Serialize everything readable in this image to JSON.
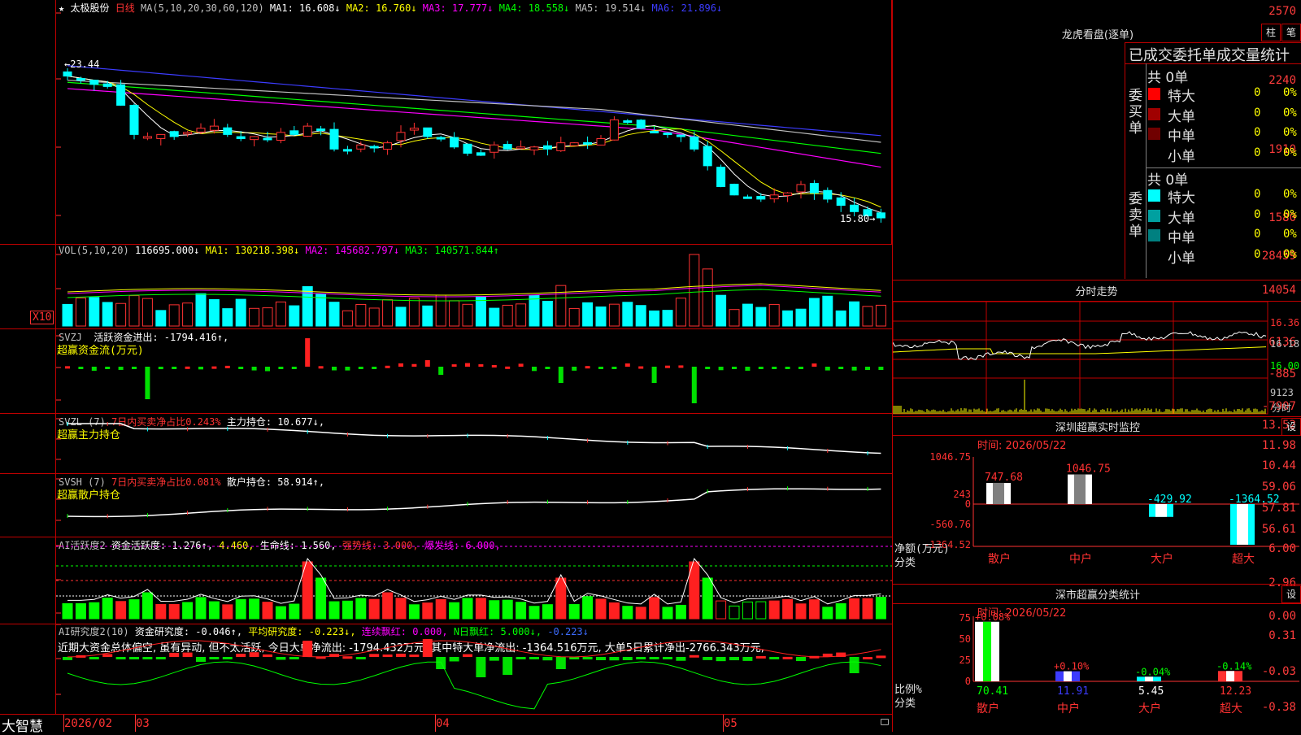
{
  "main_chart": {
    "symbol": "太极股份",
    "period": "日线",
    "ma_label": "MA(5,10,20,30,60,120)",
    "ma": [
      {
        "label": "MA1: 16.608↓",
        "color": "#ffffff"
      },
      {
        "label": "MA2: 16.760↓",
        "color": "#ffff00"
      },
      {
        "label": "MA3: 17.777↓",
        "color": "#ff00ff"
      },
      {
        "label": "MA4: 18.558↓",
        "color": "#00ff00"
      },
      {
        "label": "MA5: 19.514↓",
        "color": "#c0c0c0"
      },
      {
        "label": "MA6: 21.896↓",
        "color": "#3c3cff"
      }
    ],
    "y_ticks": [
      "2570",
      "2240",
      "1910",
      "1580"
    ],
    "high_marker": "←23.44",
    "low_marker": "15.80→"
  },
  "vol_panel": {
    "label": "VOL(5,10,20)",
    "value": "116695.000↓",
    "ma": [
      {
        "label": "MA1: 130218.398↓",
        "color": "#ffff00"
      },
      {
        "label": "MA2: 145682.797↓",
        "color": "#ff00ff"
      },
      {
        "label": "MA3: 140571.844↑",
        "color": "#00ff00"
      }
    ],
    "y_ticks": [
      "28459",
      "14054"
    ],
    "unit": "X10"
  },
  "svzj_panel": {
    "name": "SVZJ",
    "text1": "活跃资金进出: -1794.416↑,",
    "text2": "超赢资金流(万元)",
    "y_ticks": [
      "6136",
      "-885",
      "-7907"
    ]
  },
  "svzl_panel": {
    "name": "SVZL (7)",
    "text1": "7日内买卖净占比0.243%",
    "text2": "主力持仓: 10.677↓,",
    "text3": "超赢主力持仓",
    "y_ticks": [
      "13.52",
      "11.98",
      "10.44"
    ]
  },
  "svsh_panel": {
    "name": "SVSH (7)",
    "text1": "7日内买卖净占比0.081%",
    "text2": "散户持仓: 58.914↑,",
    "text3": "超赢散户持仓",
    "y_ticks": [
      "59.06",
      "57.81",
      "56.61"
    ]
  },
  "ai_active_panel": {
    "name": "AI活跃度2",
    "text1": "资金活跃度: 1.276↑,",
    "text2": "4.460,",
    "text3": "生命线: 1.560,",
    "text4": "强势线: 3.000,",
    "text5": "爆发线: 6.000,",
    "y_ticks": [
      "6.00",
      "2.96",
      "0.00"
    ]
  },
  "ai_research_panel": {
    "name": "AI研究度2(10)",
    "text1": "资金研究度: -0.046↑,",
    "text2": "平均研究度: -0.223↓,",
    "text3": "连续飘红: 0.000,",
    "text4": "N日飘红: 5.000↓,",
    "text5": "-0.223↓",
    "comment": "近期大资金总体偏空, 虽有异动, 但不太活跃, 今日大单净流出: -1794.432万元, 其中特大单净流出: -1364.516万元, 大单5日累计净出-2766.343万元,",
    "y_ticks": [
      "0.31",
      "-0.03",
      "-0.38"
    ]
  },
  "bottom_bar": {
    "app_name": "大智慧",
    "dates": [
      "2026/02",
      "03",
      "04",
      "05"
    ]
  },
  "lhb": {
    "title": "龙虎看盘(逐单)",
    "btn1": "柱",
    "btn2": "笔",
    "header": "已成交委托单成交量统计",
    "buy_label": "委买单",
    "sell_label": "委卖单",
    "buy_total": "共 0单",
    "sell_total": "共 0单",
    "buy_rows": [
      {
        "label": "特大",
        "count": "0",
        "pct": "0%",
        "color": "#ff0000"
      },
      {
        "label": "大单",
        "count": "0",
        "pct": "0%",
        "color": "#a00000"
      },
      {
        "label": "中单",
        "count": "0",
        "pct": "0%",
        "color": "#700000"
      },
      {
        "label": "小单",
        "count": "0",
        "pct": "0%",
        "color": "#000000"
      }
    ],
    "sell_rows": [
      {
        "label": "特大",
        "count": "0",
        "pct": "0%",
        "color": "#00ffff"
      },
      {
        "label": "大单",
        "count": "0",
        "pct": "0%",
        "color": "#00a0a0"
      },
      {
        "label": "中单",
        "count": "0",
        "pct": "0%",
        "color": "#008080"
      },
      {
        "label": "小单",
        "count": "0",
        "pct": "0%",
        "color": "#000000"
      }
    ]
  },
  "intraday": {
    "title": "分时走势",
    "y_ticks": [
      "16.36",
      "16.18",
      "16.00"
    ],
    "vol_tick": "9123",
    "vol_label": "分时"
  },
  "sz_monitor": {
    "title": "深圳超赢实时监控",
    "btn": "设",
    "time": "时间: 2026/05/22",
    "y_ticks": [
      "1046.75",
      "243",
      "0",
      "-560.76",
      "-1364.52"
    ],
    "axis_label1": "净额(万元)",
    "axis_label2": "分类",
    "bars": [
      {
        "label": "散户",
        "value": 747.68,
        "text": "747.68"
      },
      {
        "label": "中户",
        "value": 1046.75,
        "text": "1046.75"
      },
      {
        "label": "大户",
        "value": -429.92,
        "text": "-429.92"
      },
      {
        "label": "超大",
        "value": -1364.52,
        "text": "-1364.52"
      }
    ]
  },
  "sz_class": {
    "title": "深市超赢分类统计",
    "btn": "设",
    "time": "时间: 2026/05/22",
    "y_ticks": [
      "75",
      "50",
      "25",
      "0"
    ],
    "axis_label1": "比例%",
    "axis_label2": "分类",
    "bars": [
      {
        "label": "散户",
        "value": 70.41,
        "text": "70.41",
        "delta": "+0.08%"
      },
      {
        "label": "中户",
        "value": 11.91,
        "text": "11.91",
        "delta": "+0.10%"
      },
      {
        "label": "大户",
        "value": 5.45,
        "text": "5.45",
        "delta": "-0.04%"
      },
      {
        "label": "超大",
        "value": 12.23,
        "text": "12.23",
        "delta": "-0.14%"
      }
    ]
  }
}
